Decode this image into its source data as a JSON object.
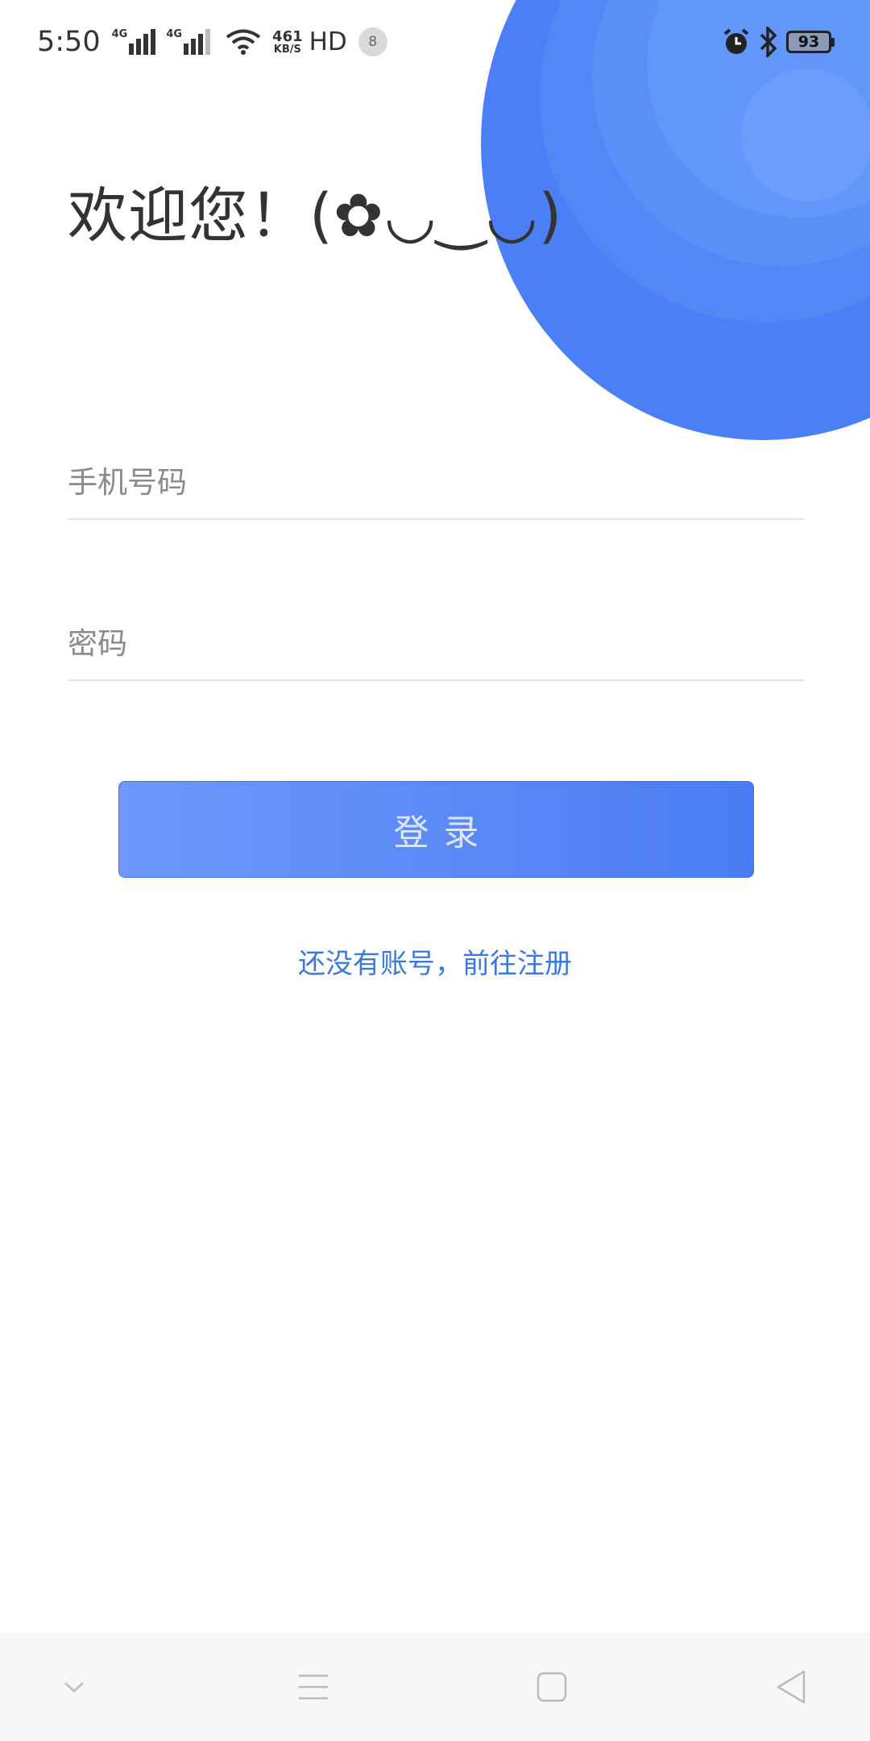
{
  "status_bar": {
    "time": "5:50",
    "signal1_tag": "4G",
    "signal2_tag": "4G",
    "net_speed_value": "461",
    "net_speed_unit": "KB/S",
    "hd_label": "HD",
    "notification_count": "8",
    "battery_level": "93"
  },
  "login": {
    "welcome_text": "欢迎您！(✿◡‿◡)",
    "phone_placeholder": "手机号码",
    "password_placeholder": "密码",
    "login_button_label": "登录",
    "register_link_text": "还没有账号，前往注册"
  },
  "colors": {
    "accent": "#4b7ff5",
    "link": "#3d79dc",
    "button_gradient_start": "#6e99fb",
    "button_gradient_end": "#4a7cf3"
  },
  "nav_bar": {
    "icons": [
      "chevron-down-icon",
      "menu-icon",
      "home-square-icon",
      "back-triangle-icon"
    ]
  }
}
